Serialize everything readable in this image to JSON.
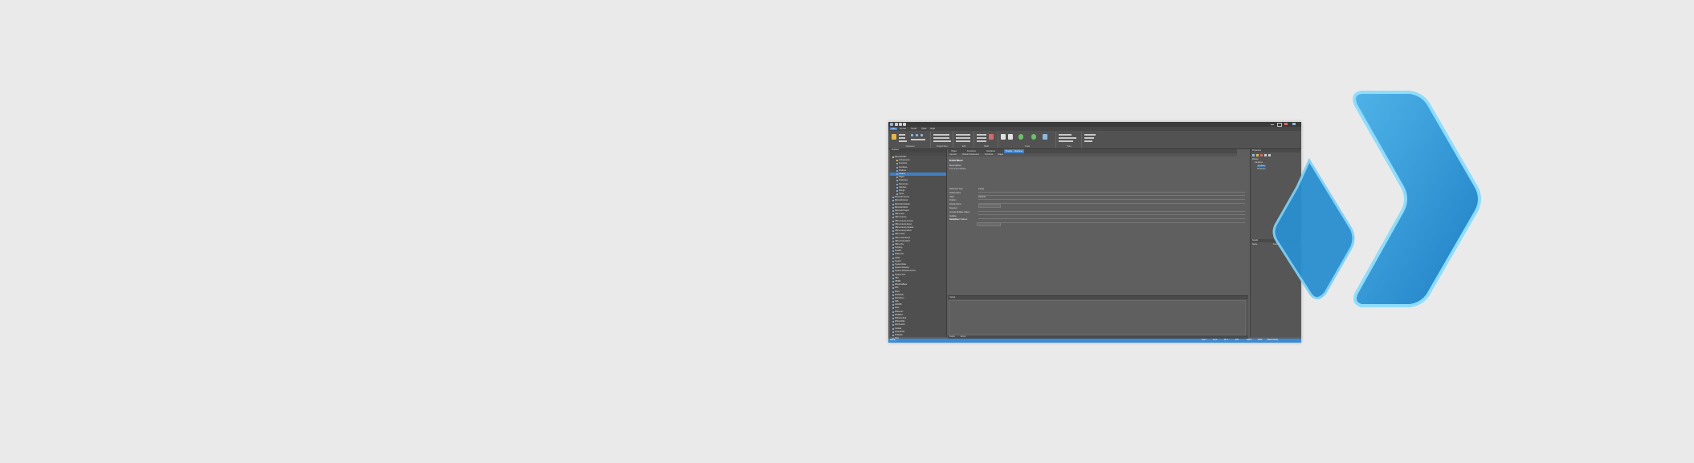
{
  "window": {
    "title": "",
    "menus": [
      "File",
      "Home",
      "Tools",
      "View",
      "Help"
    ],
    "active_menu": "Home"
  },
  "ribbon": {
    "groups": [
      {
        "caption": "Clipboard"
      },
      {
        "caption": "Project Files"
      },
      {
        "caption": "Edit"
      },
      {
        "caption": "Build"
      },
      {
        "caption": "Tools"
      },
      {
        "caption": "Help"
      }
    ]
  },
  "explorer": {
    "header": "Explorer",
    "items": [
      "Microsoft.Win",
      "Components",
      "Functions",
      "Interfaces",
      "Modules",
      "Module",
      "Object",
      "Properties",
      "Resources",
      "Samples",
      "Strings",
      "Types",
      "Microsoft.Access",
      "Microsoft.Excel",
      "Microsoft.Outlook",
      "Microsoft.Word",
      "Microsoft.Project",
      "Office.Core",
      "Office.Interop",
      "Office.Interop.Access",
      "Office.Interop.Excel",
      "Office.Interop.Outlook",
      "Office.Interop.Word",
      "Office.Tools",
      "Office.Tools.Excel",
      "Office.Tools.Word",
      "Office.Vbe",
      "Scripting",
      "Shell32",
      "SHDocVw",
      "stdole",
      "System",
      "System.Data",
      "System.Drawing",
      "System.Windows.Forms",
      "System.Xml",
      "VBA",
      "VBIDE",
      "WindowsBase",
      "WIA",
      "Word",
      "Workbook",
      "Worksheet",
      "XML",
      "ADODB",
      "DAO",
      "MSForms",
      "MSXML2",
      "MSComctlLib",
      "MSComDlg",
      "RichTextLib",
      "Outlook",
      "PowerPoint",
      "Publisher",
      "Visio",
      "Access",
      "Excel",
      "Project",
      "OneNote",
      "InfoPath",
      "SharePoint",
      "Lync",
      "Groove",
      "Skype",
      "Teams"
    ],
    "selected_index": 5
  },
  "document": {
    "tabs": [
      "Object",
      "Functions",
      "Interfaces",
      "Module - Interfaces"
    ],
    "active_tab": 3,
    "subtabs": [
      "General",
      "Module Parameters",
      "Functions",
      "Usage"
    ],
    "heading": "Interface",
    "description_label": "Description",
    "description_text": "This is the interface",
    "fields": [
      {
        "label": "Parameter Type",
        "value": "Integer",
        "kind": "text"
      },
      {
        "label": "Default Value",
        "value": "",
        "kind": "line"
      },
      {
        "label": "Value",
        "value": "Optional",
        "kind": "text"
      },
      {
        "label": "Position",
        "value": "",
        "kind": "line"
      },
      {
        "label": "Display Name",
        "value": "",
        "kind": "box"
      },
      {
        "label": "Required",
        "value": "",
        "kind": "line"
      },
      {
        "label": "Accepts Multiple Values",
        "value": "",
        "kind": "line"
      },
      {
        "label": "Nullable",
        "value": "",
        "kind": "line"
      },
      {
        "label": "Read Only",
        "value": "",
        "kind": "line"
      }
    ],
    "accepted_values_label": "Accepted Values"
  },
  "output": {
    "header": "Output"
  },
  "bottom_tabs": [
    "Output",
    "Errors"
  ],
  "properties": {
    "header": "Properties",
    "tree_items": [
      "Module",
      "Interfaces",
      "Interface",
      "Parameter"
    ],
    "detail_header": "Details",
    "detail_key": "Name",
    "detail_value": "Interface"
  },
  "status": {
    "left": "Ready",
    "right": [
      "Line 1",
      "Col 1",
      "Ch 1",
      "INS",
      "CAPS",
      "NUM",
      "Build: Ready"
    ]
  },
  "colors": {
    "accent": "#3b8bd4",
    "logo_blue": "#2a8fd0"
  },
  "icons": {
    "logo": "double-chevron-logo"
  }
}
